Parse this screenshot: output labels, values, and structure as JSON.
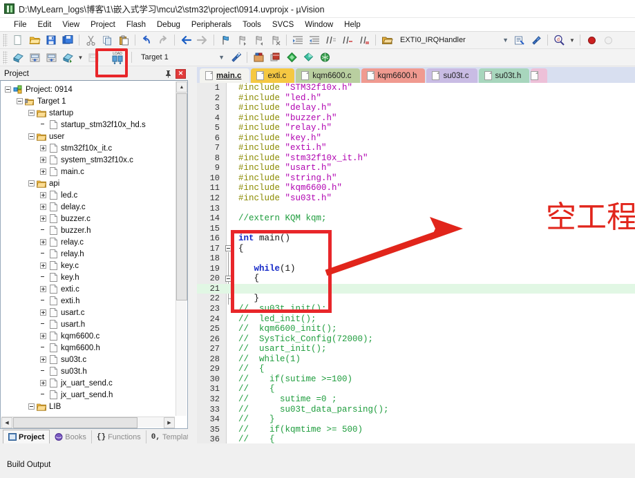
{
  "window": {
    "title": "D:\\MyLearn_logs\\博客\\1\\嵌入式学习\\mcu\\2\\stm32\\project\\0914.uvprojx - µVision",
    "app_icon": "uvision-icon"
  },
  "menu": {
    "items": [
      "File",
      "Edit",
      "View",
      "Project",
      "Flash",
      "Debug",
      "Peripherals",
      "Tools",
      "SVCS",
      "Window",
      "Help"
    ]
  },
  "toolbar_main": {
    "buttons": [
      "new-file-icon",
      "open-file-icon",
      "save-icon",
      "save-all-icon",
      "cut-icon",
      "copy-icon",
      "paste-icon",
      "undo-icon",
      "redo-icon",
      "navigate-back-icon",
      "navigate-forward-icon",
      "bookmark-toggle-icon",
      "bookmark-prev-icon",
      "bookmark-next-icon",
      "bookmark-clear-icon",
      "indent-icon",
      "outdent-icon",
      "comment-icon",
      "uncomment-icon",
      "uncomment-block-icon"
    ],
    "function_selector": {
      "icon": "function-browser-icon",
      "value": "EXTI0_IRQHandler",
      "chevron": "chevron-down-icon"
    },
    "right_buttons": [
      "open-file-browser-icon",
      "configure-icon",
      "find-in-files-icon",
      "start-debug-icon",
      "stop-debug-icon"
    ]
  },
  "toolbar_build": {
    "buttons": [
      "translate-icon",
      "build-icon",
      "rebuild-icon",
      "batch-build-icon",
      "stop-build-icon",
      "download-to-flash-icon"
    ],
    "target_value": "Target 1",
    "chevron": "chevron-down-icon",
    "right_buttons": [
      "target-options-icon",
      "manage-components-icon",
      "pack-installer-icon",
      "manage-runtime-icon",
      "multi-project-icon",
      "pack-icon"
    ]
  },
  "project_panel": {
    "title": "Project",
    "pin_icon": "pin-icon",
    "close_icon": "close-icon",
    "tree": [
      {
        "label": "Project: 0914",
        "depth": 0,
        "expander": "minus",
        "icon": "project-icon"
      },
      {
        "label": "Target 1",
        "depth": 1,
        "expander": "minus",
        "icon": "target-icon"
      },
      {
        "label": "startup",
        "depth": 2,
        "expander": "minus",
        "icon": "folder-icon"
      },
      {
        "label": "startup_stm32f10x_hd.s",
        "depth": 3,
        "expander": "none",
        "icon": "file-icon"
      },
      {
        "label": "user",
        "depth": 2,
        "expander": "minus",
        "icon": "folder-icon"
      },
      {
        "label": "stm32f10x_it.c",
        "depth": 3,
        "expander": "plus",
        "icon": "file-icon"
      },
      {
        "label": "system_stm32f10x.c",
        "depth": 3,
        "expander": "plus",
        "icon": "file-icon"
      },
      {
        "label": "main.c",
        "depth": 3,
        "expander": "plus",
        "icon": "file-icon"
      },
      {
        "label": "api",
        "depth": 2,
        "expander": "minus",
        "icon": "folder-icon"
      },
      {
        "label": "led.c",
        "depth": 3,
        "expander": "plus",
        "icon": "file-icon"
      },
      {
        "label": "delay.c",
        "depth": 3,
        "expander": "plus",
        "icon": "file-icon"
      },
      {
        "label": "buzzer.c",
        "depth": 3,
        "expander": "plus",
        "icon": "file-icon"
      },
      {
        "label": "buzzer.h",
        "depth": 3,
        "expander": "none",
        "icon": "file-icon"
      },
      {
        "label": "relay.c",
        "depth": 3,
        "expander": "plus",
        "icon": "file-icon"
      },
      {
        "label": "relay.h",
        "depth": 3,
        "expander": "none",
        "icon": "file-icon"
      },
      {
        "label": "key.c",
        "depth": 3,
        "expander": "plus",
        "icon": "file-icon"
      },
      {
        "label": "key.h",
        "depth": 3,
        "expander": "none",
        "icon": "file-icon"
      },
      {
        "label": "exti.c",
        "depth": 3,
        "expander": "plus",
        "icon": "file-icon"
      },
      {
        "label": "exti.h",
        "depth": 3,
        "expander": "none",
        "icon": "file-icon"
      },
      {
        "label": "usart.c",
        "depth": 3,
        "expander": "plus",
        "icon": "file-icon"
      },
      {
        "label": "usart.h",
        "depth": 3,
        "expander": "none",
        "icon": "file-icon"
      },
      {
        "label": "kqm6600.c",
        "depth": 3,
        "expander": "plus",
        "icon": "file-icon"
      },
      {
        "label": "kqm6600.h",
        "depth": 3,
        "expander": "none",
        "icon": "file-icon"
      },
      {
        "label": "su03t.c",
        "depth": 3,
        "expander": "plus",
        "icon": "file-icon"
      },
      {
        "label": "su03t.h",
        "depth": 3,
        "expander": "none",
        "icon": "file-icon"
      },
      {
        "label": "jx_uart_send.c",
        "depth": 3,
        "expander": "plus",
        "icon": "file-icon"
      },
      {
        "label": "jx_uart_send.h",
        "depth": 3,
        "expander": "none",
        "icon": "file-icon"
      },
      {
        "label": "LIB",
        "depth": 2,
        "expander": "minus",
        "icon": "folder-icon"
      }
    ],
    "tabs": [
      {
        "label": "Project",
        "icon": "project-tab-icon",
        "active": true
      },
      {
        "label": "Books",
        "icon": "books-tab-icon",
        "active": false
      },
      {
        "label": "Functions",
        "icon": "functions-tab-icon",
        "active": false
      },
      {
        "label": "Templates",
        "icon": "templates-tab-icon",
        "active": false
      }
    ]
  },
  "editor": {
    "tabs": [
      {
        "label": "main.c",
        "color": "#f3f3ef",
        "active": true
      },
      {
        "label": "exti.c",
        "color": "#f5c842",
        "active": false
      },
      {
        "label": "kqm6600.c",
        "color": "#b9cfa0",
        "active": false
      },
      {
        "label": "kqm6600.h",
        "color": "#f09a90",
        "active": false
      },
      {
        "label": "su03t.c",
        "color": "#c9bce4",
        "active": false
      },
      {
        "label": "su03t.h",
        "color": "#a8d6bd",
        "active": false
      },
      {
        "label": "",
        "color": "#edc0d8",
        "active": false
      }
    ],
    "lines": [
      {
        "n": 1,
        "tokens": [
          {
            "t": "#include ",
            "c": "pp"
          },
          {
            "t": "\"STM32f10x.h\"",
            "c": "str"
          }
        ]
      },
      {
        "n": 2,
        "tokens": [
          {
            "t": "#include ",
            "c": "pp"
          },
          {
            "t": "\"led.h\"",
            "c": "str"
          }
        ]
      },
      {
        "n": 3,
        "tokens": [
          {
            "t": "#include ",
            "c": "pp"
          },
          {
            "t": "\"delay.h\"",
            "c": "str"
          }
        ]
      },
      {
        "n": 4,
        "tokens": [
          {
            "t": "#include ",
            "c": "pp"
          },
          {
            "t": "\"buzzer.h\"",
            "c": "str"
          }
        ]
      },
      {
        "n": 5,
        "tokens": [
          {
            "t": "#include ",
            "c": "pp"
          },
          {
            "t": "\"relay.h\"",
            "c": "str"
          }
        ]
      },
      {
        "n": 6,
        "tokens": [
          {
            "t": "#include ",
            "c": "pp"
          },
          {
            "t": "\"key.h\"",
            "c": "str"
          }
        ]
      },
      {
        "n": 7,
        "tokens": [
          {
            "t": "#include ",
            "c": "pp"
          },
          {
            "t": "\"exti.h\"",
            "c": "str"
          }
        ]
      },
      {
        "n": 8,
        "tokens": [
          {
            "t": "#include ",
            "c": "pp"
          },
          {
            "t": "\"stm32f10x_it.h\"",
            "c": "str"
          }
        ]
      },
      {
        "n": 9,
        "tokens": [
          {
            "t": "#include ",
            "c": "pp"
          },
          {
            "t": "\"usart.h\"",
            "c": "str"
          }
        ]
      },
      {
        "n": 10,
        "tokens": [
          {
            "t": "#include ",
            "c": "pp"
          },
          {
            "t": "\"string.h\"",
            "c": "str"
          }
        ]
      },
      {
        "n": 11,
        "tokens": [
          {
            "t": "#include ",
            "c": "pp"
          },
          {
            "t": "\"kqm6600.h\"",
            "c": "str"
          }
        ]
      },
      {
        "n": 12,
        "tokens": [
          {
            "t": "#include ",
            "c": "pp"
          },
          {
            "t": "\"su03t.h\"",
            "c": "str"
          }
        ]
      },
      {
        "n": 13,
        "tokens": []
      },
      {
        "n": 14,
        "tokens": [
          {
            "t": "//extern KQM kqm;",
            "c": "cmt"
          }
        ]
      },
      {
        "n": 15,
        "tokens": []
      },
      {
        "n": 16,
        "tokens": [
          {
            "t": "int",
            "c": "kw"
          },
          {
            "t": " main()",
            "c": "plain"
          }
        ],
        "fold": "box"
      },
      {
        "n": 17,
        "tokens": [
          {
            "t": "{",
            "c": "plain"
          }
        ],
        "fold": "box2"
      },
      {
        "n": 18,
        "tokens": []
      },
      {
        "n": 19,
        "tokens": [
          {
            "t": "   ",
            "c": "plain"
          },
          {
            "t": "while",
            "c": "kw"
          },
          {
            "t": "(1)",
            "c": "plain"
          }
        ]
      },
      {
        "n": 20,
        "tokens": [
          {
            "t": "   {",
            "c": "plain"
          }
        ],
        "fold": "box3"
      },
      {
        "n": 21,
        "tokens": [],
        "highlight": true
      },
      {
        "n": 22,
        "tokens": [
          {
            "t": "   }",
            "c": "plain"
          }
        ],
        "fold": "tick"
      },
      {
        "n": 23,
        "tokens": [
          {
            "t": "//  su03t_init();",
            "c": "cmt"
          }
        ]
      },
      {
        "n": 24,
        "tokens": [
          {
            "t": "//  led_init();",
            "c": "cmt"
          }
        ]
      },
      {
        "n": 25,
        "tokens": [
          {
            "t": "//  kqm6600_init();",
            "c": "cmt"
          }
        ]
      },
      {
        "n": 26,
        "tokens": [
          {
            "t": "//  SysTick_Config(72000);",
            "c": "cmt"
          }
        ]
      },
      {
        "n": 27,
        "tokens": [
          {
            "t": "//  usart_init();",
            "c": "cmt"
          }
        ]
      },
      {
        "n": 28,
        "tokens": [
          {
            "t": "//  while(1)",
            "c": "cmt"
          }
        ]
      },
      {
        "n": 29,
        "tokens": [
          {
            "t": "//  {",
            "c": "cmt"
          }
        ]
      },
      {
        "n": 30,
        "tokens": [
          {
            "t": "//    if(sutime >=100)",
            "c": "cmt"
          }
        ]
      },
      {
        "n": 31,
        "tokens": [
          {
            "t": "//    {",
            "c": "cmt"
          }
        ]
      },
      {
        "n": 32,
        "tokens": [
          {
            "t": "//      sutime =0 ;",
            "c": "cmt"
          }
        ]
      },
      {
        "n": 33,
        "tokens": [
          {
            "t": "//      su03t_data_parsing();",
            "c": "cmt"
          }
        ]
      },
      {
        "n": 34,
        "tokens": [
          {
            "t": "//    }",
            "c": "cmt"
          }
        ]
      },
      {
        "n": 35,
        "tokens": [
          {
            "t": "//    if(kqmtime >= 500)",
            "c": "cmt"
          }
        ]
      },
      {
        "n": 36,
        "tokens": [
          {
            "t": "//    {",
            "c": "cmt"
          }
        ]
      }
    ]
  },
  "annotations": {
    "color": "#e1251b",
    "chinese_label": "空工程",
    "arrow_icon": "red-arrow-icon",
    "code_box_icon": "red-rectangle-highlight",
    "toolbar_box_icon": "red-rectangle-highlight"
  },
  "build_output": {
    "title": "Build Output"
  }
}
